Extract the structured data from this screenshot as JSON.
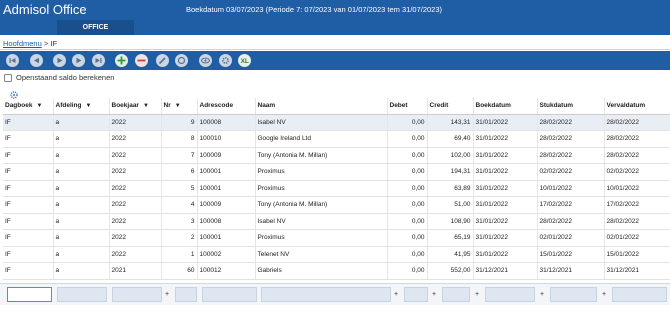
{
  "app": {
    "title": "Admisol Office",
    "header_info": "Boekdatum 03/07/2023 (Periode 7: 07/2023 van 01/07/2023 tem 31/07/2023)"
  },
  "tabs": [
    {
      "label": "OFFICE",
      "active": true
    }
  ],
  "breadcrumb": {
    "home": "Hoofdmenu",
    "separator": ">",
    "current": "IF"
  },
  "toolbar": {
    "buttons": [
      {
        "name": "first-record-button",
        "icon": "skip-back-icon"
      },
      {
        "name": "previous-record-button",
        "icon": "previous-icon"
      },
      {
        "name": "play-button",
        "icon": "play-icon"
      },
      {
        "name": "last-record-button",
        "icon": "skip-forward-icon"
      },
      {
        "name": "add-button",
        "icon": "plus-icon"
      },
      {
        "name": "delete-button",
        "icon": "minus-icon"
      },
      {
        "name": "edit-button",
        "icon": "pencil-icon"
      },
      {
        "name": "refresh-button",
        "icon": "refresh-icon"
      },
      {
        "name": "preview-button",
        "icon": "eye-icon"
      },
      {
        "name": "settings-button",
        "icon": "cog-icon"
      },
      {
        "name": "excel-export-button",
        "icon": "excel-icon"
      }
    ]
  },
  "options": {
    "open_balance_label": "Openstaand saldo berekenen",
    "open_balance_checked": false
  },
  "table": {
    "columns": [
      "Dagboek",
      "Afdeling",
      "Boekjaar",
      "Nr",
      "Adrescode",
      "Naam",
      "Debet",
      "Credit",
      "Boekdatum",
      "Stukdatum",
      "Vervaldatum"
    ],
    "sortable": [
      true,
      true,
      true,
      true,
      false,
      false,
      false,
      false,
      false,
      false,
      false
    ],
    "rows": [
      [
        "IF",
        "a",
        "2022",
        "9",
        "100008",
        "Isabel NV",
        "0,00",
        "143,31",
        "31/01/2022",
        "28/02/2022",
        "28/02/2022"
      ],
      [
        "IF",
        "a",
        "2022",
        "8",
        "100010",
        "Google Ireland Ltd",
        "0,00",
        "69,40",
        "31/01/2022",
        "28/02/2022",
        "28/02/2022"
      ],
      [
        "IF",
        "a",
        "2022",
        "7",
        "100009",
        "Tony (Antonia M. Millan)",
        "0,00",
        "102,00",
        "31/01/2022",
        "28/02/2022",
        "28/02/2022"
      ],
      [
        "IF",
        "a",
        "2022",
        "6",
        "100001",
        "Proximus",
        "0,00",
        "194,31",
        "31/01/2022",
        "02/02/2022",
        "02/02/2022"
      ],
      [
        "IF",
        "a",
        "2022",
        "5",
        "100001",
        "Proximus",
        "0,00",
        "63,89",
        "31/01/2022",
        "10/01/2022",
        "10/01/2022"
      ],
      [
        "IF",
        "a",
        "2022",
        "4",
        "100009",
        "Tony (Antonia M. Millan)",
        "0,00",
        "51,00",
        "31/01/2022",
        "17/02/2022",
        "17/02/2022"
      ],
      [
        "IF",
        "a",
        "2022",
        "3",
        "100008",
        "Isabel NV",
        "0,00",
        "108,90",
        "31/01/2022",
        "28/02/2022",
        "28/02/2022"
      ],
      [
        "IF",
        "a",
        "2022",
        "2",
        "100001",
        "Proximus",
        "0,00",
        "65,19",
        "31/01/2022",
        "02/01/2022",
        "02/01/2022"
      ],
      [
        "IF",
        "a",
        "2022",
        "1",
        "100002",
        "Telenet NV",
        "0,00",
        "41,95",
        "31/01/2022",
        "15/01/2022",
        "15/01/2022"
      ],
      [
        "IF",
        "a",
        "2021",
        "60",
        "100012",
        "Gabriels",
        "0,00",
        "552,00",
        "31/12/2021",
        "31/12/2021",
        "31/12/2021"
      ]
    ]
  },
  "filters": {
    "plus_symbol": "+"
  },
  "colors": {
    "brand_blue": "#1f5ea5",
    "tab_active": "#1a4f8e",
    "add_green": "#2e9e3a",
    "delete_red": "#d13b3b"
  }
}
